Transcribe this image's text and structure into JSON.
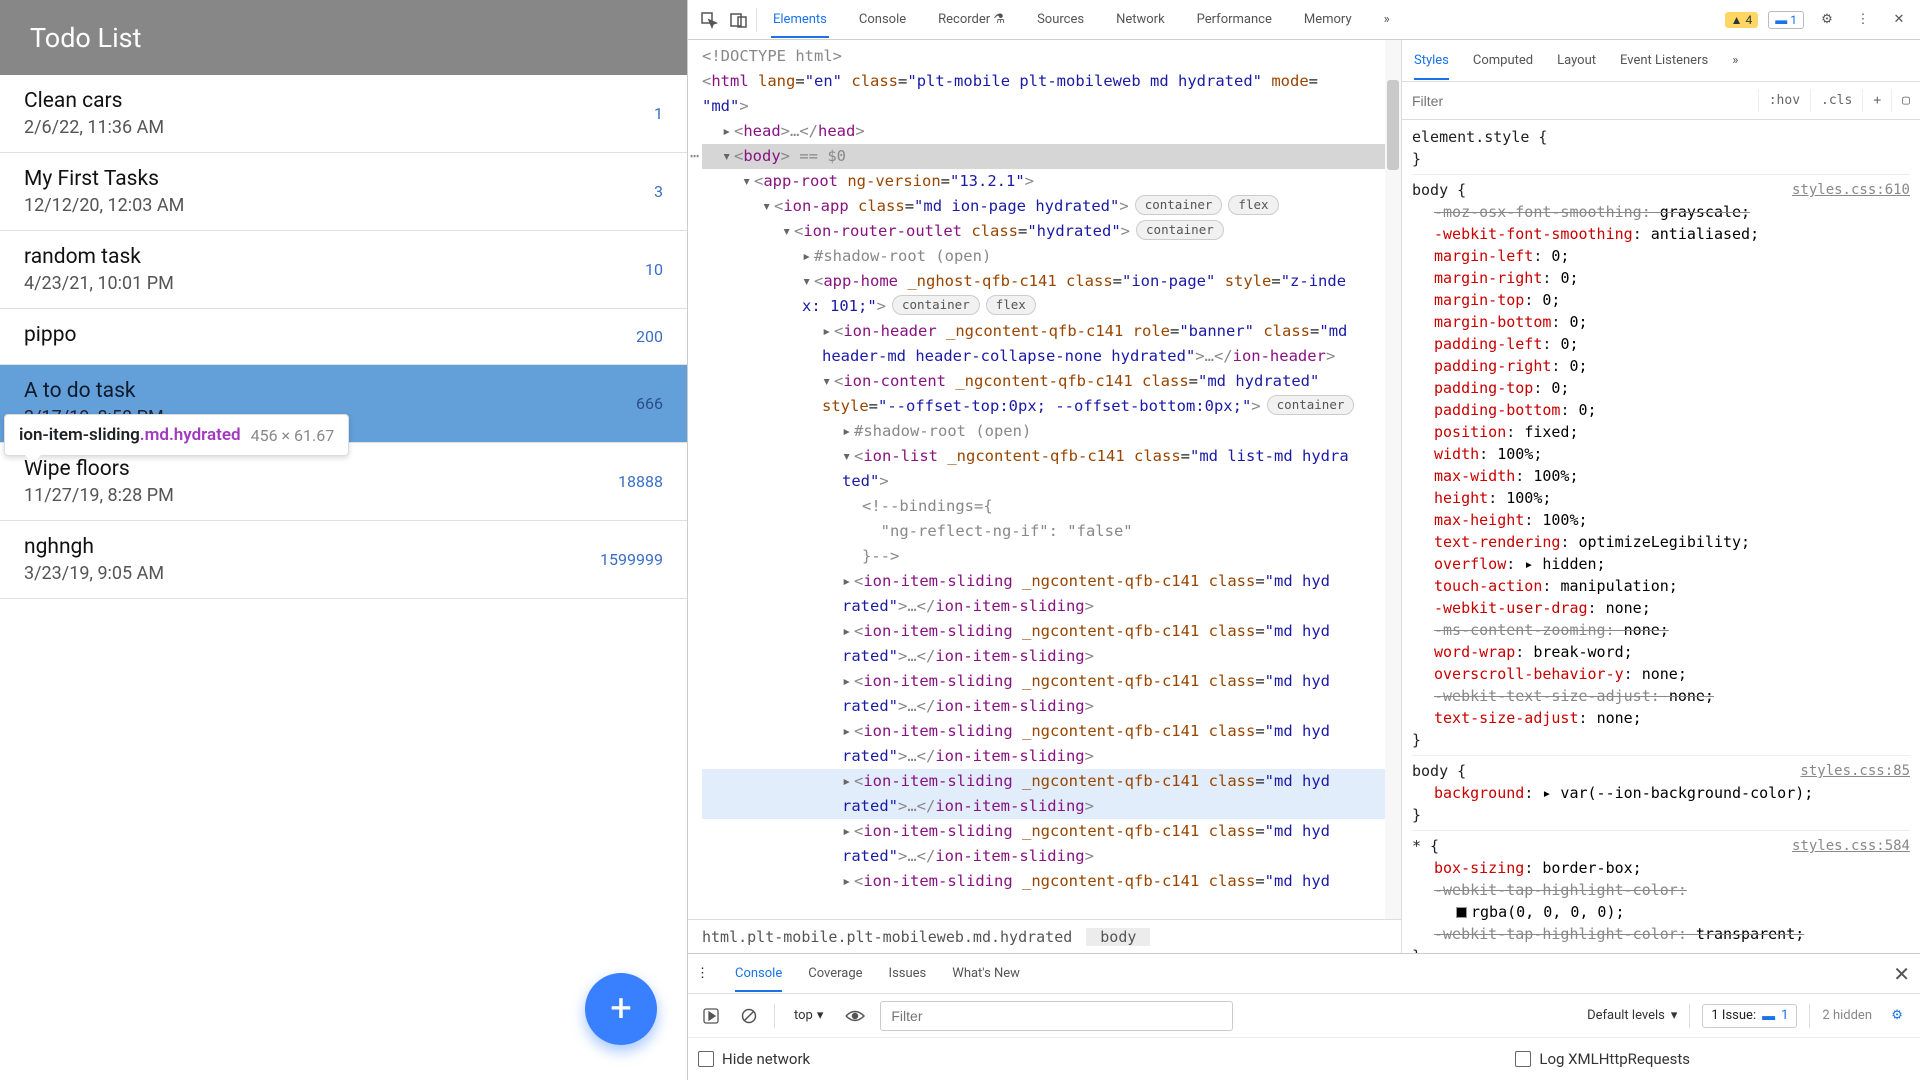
{
  "todo": {
    "header": "Todo List",
    "items": [
      {
        "title": "Clean cars",
        "date": "2/6/22, 11:36 AM",
        "badge": "1"
      },
      {
        "title": "My First Tasks",
        "date": "12/12/20, 12:03 AM",
        "badge": "3"
      },
      {
        "title": "random task",
        "date": "4/23/21, 10:01 PM",
        "badge": "10"
      },
      {
        "title": "pippo",
        "date": "",
        "badge": "200"
      },
      {
        "title": "A to do task",
        "date": "3/17/19, 8:58 PM",
        "badge": "666",
        "selected": true
      },
      {
        "title": "Wipe floors",
        "date": "11/27/19, 8:28 PM",
        "badge": "18888"
      },
      {
        "title": "nghngh",
        "date": "3/23/19, 9:05 AM",
        "badge": "1599999"
      }
    ],
    "tooltip": {
      "sel": "ion-item-sliding",
      "mod": ".md.hydrated",
      "dim": "456 × 61.67"
    },
    "fab_label": "+"
  },
  "devtools": {
    "top_tabs": [
      "Elements",
      "Console",
      "Recorder",
      "Sources",
      "Network",
      "Performance",
      "Memory"
    ],
    "top_active": "Elements",
    "warn_count": "4",
    "info_count": "1",
    "crumb": [
      "html.plt-mobile.plt-mobileweb.md.hydrated",
      "body"
    ],
    "dom": {
      "doctype": "<!DOCTYPE html>",
      "html_open": {
        "tag": "html",
        "attrs": "lang=\"en\" class=\"plt-mobile plt-mobileweb md hydrated\" mode=\"md\""
      },
      "head": "<head>…</head>",
      "body_open": "<body>",
      "body_sel_eq": " == $0",
      "approot": {
        "tag": "app-root",
        "attrs": "ng-version=\"13.2.1\""
      },
      "ionapp": {
        "tag": "ion-app",
        "attrs": "class=\"md ion-page hydrated\"",
        "pills": [
          "container",
          "flex"
        ]
      },
      "router": {
        "tag": "ion-router-outlet",
        "attrs": "class=\"hydrated\"",
        "pills": [
          "container"
        ]
      },
      "shadow1": "#shadow-root (open)",
      "apphome": {
        "tag": "app-home",
        "attrs": "_nghost-qfb-c141 class=\"ion-page\" style=\"z-index: 101;\"",
        "pills": [
          "container",
          "flex"
        ]
      },
      "ionheader": {
        "open": "<ion-header _ngcontent-qfb-c141 role=\"banner\" class=\"md header-md header-collapse-none hydrated\">",
        "close": "…</ion-header>"
      },
      "ioncontent": {
        "open": "<ion-content _ngcontent-qfb-c141 class=\"md hydrated\" style=\"--offset-top:0px; --offset-bottom:0px;\">",
        "pills": [
          "container"
        ]
      },
      "shadow2": "#shadow-root (open)",
      "ionlist": "<ion-list _ngcontent-qfb-c141 class=\"md list-md hydrated\">",
      "bindings": [
        "<!--bindings={",
        "  \"ng-reflect-ng-if\": \"false\"",
        "}-->"
      ],
      "sliding_open": "<ion-item-sliding _ngcontent-qfb-c141 class=\"md hydrated\">",
      "sliding_close": "…</ion-item-sliding>",
      "sliding_count": 7
    },
    "styles": {
      "tabs": [
        "Styles",
        "Computed",
        "Layout",
        "Event Listeners"
      ],
      "tabs_active": "Styles",
      "filter_placeholder": "Filter",
      "btn_hov": ":hov",
      "btn_cls": ".cls",
      "element_style": "element.style {",
      "rules": [
        {
          "selector": "body {",
          "origin": "styles.css:610",
          "props": [
            {
              "n": "-moz-osx-font-smoothing",
              "v": "grayscale;",
              "strike": true
            },
            {
              "n": "-webkit-font-smoothing",
              "v": "antialiased;"
            },
            {
              "n": "margin-left",
              "v": "0;"
            },
            {
              "n": "margin-right",
              "v": "0;"
            },
            {
              "n": "margin-top",
              "v": "0;"
            },
            {
              "n": "margin-bottom",
              "v": "0;"
            },
            {
              "n": "padding-left",
              "v": "0;"
            },
            {
              "n": "padding-right",
              "v": "0;"
            },
            {
              "n": "padding-top",
              "v": "0;"
            },
            {
              "n": "padding-bottom",
              "v": "0;"
            },
            {
              "n": "position",
              "v": "fixed;"
            },
            {
              "n": "width",
              "v": "100%;"
            },
            {
              "n": "max-width",
              "v": "100%;"
            },
            {
              "n": "height",
              "v": "100%;"
            },
            {
              "n": "max-height",
              "v": "100%;"
            },
            {
              "n": "text-rendering",
              "v": "optimizeLegibility;"
            },
            {
              "n": "overflow",
              "v": "▸ hidden;"
            },
            {
              "n": "touch-action",
              "v": "manipulation;"
            },
            {
              "n": "-webkit-user-drag",
              "v": "none;"
            },
            {
              "n": "-ms-content-zooming",
              "v": "none;",
              "strike": true
            },
            {
              "n": "word-wrap",
              "v": "break-word;"
            },
            {
              "n": "overscroll-behavior-y",
              "v": "none;"
            },
            {
              "n": "-webkit-text-size-adjust",
              "v": "none;",
              "strike": true
            },
            {
              "n": "text-size-adjust",
              "v": "none;"
            }
          ]
        },
        {
          "selector": "body {",
          "origin": "styles.css:85",
          "props": [
            {
              "n": "background",
              "v": "▸ var(--ion-background-color);"
            }
          ]
        },
        {
          "selector": "* {",
          "origin": "styles.css:584",
          "props": [
            {
              "n": "box-sizing",
              "v": "border-box;"
            },
            {
              "n": "-webkit-tap-highlight-color",
              "v": "",
              "strike": true
            },
            {
              "n": "",
              "v": "rgba(0, 0, 0, 0);",
              "swatch": true,
              "indent": true
            },
            {
              "n": "-webkit-tap-highlight-color",
              "v": "transparent;",
              "strike": true,
              "cutoff": true
            }
          ]
        }
      ]
    },
    "drawer": {
      "tabs": [
        "Console",
        "Coverage",
        "Issues",
        "What's New"
      ],
      "tabs_active": "Console",
      "context": "top",
      "filter_placeholder": "Filter",
      "levels": "Default levels",
      "issue_label": "1 Issue:",
      "issue_count": "1",
      "hidden": "2 hidden",
      "hide_network": "Hide network",
      "log_xhr": "Log XMLHttpRequests"
    }
  }
}
